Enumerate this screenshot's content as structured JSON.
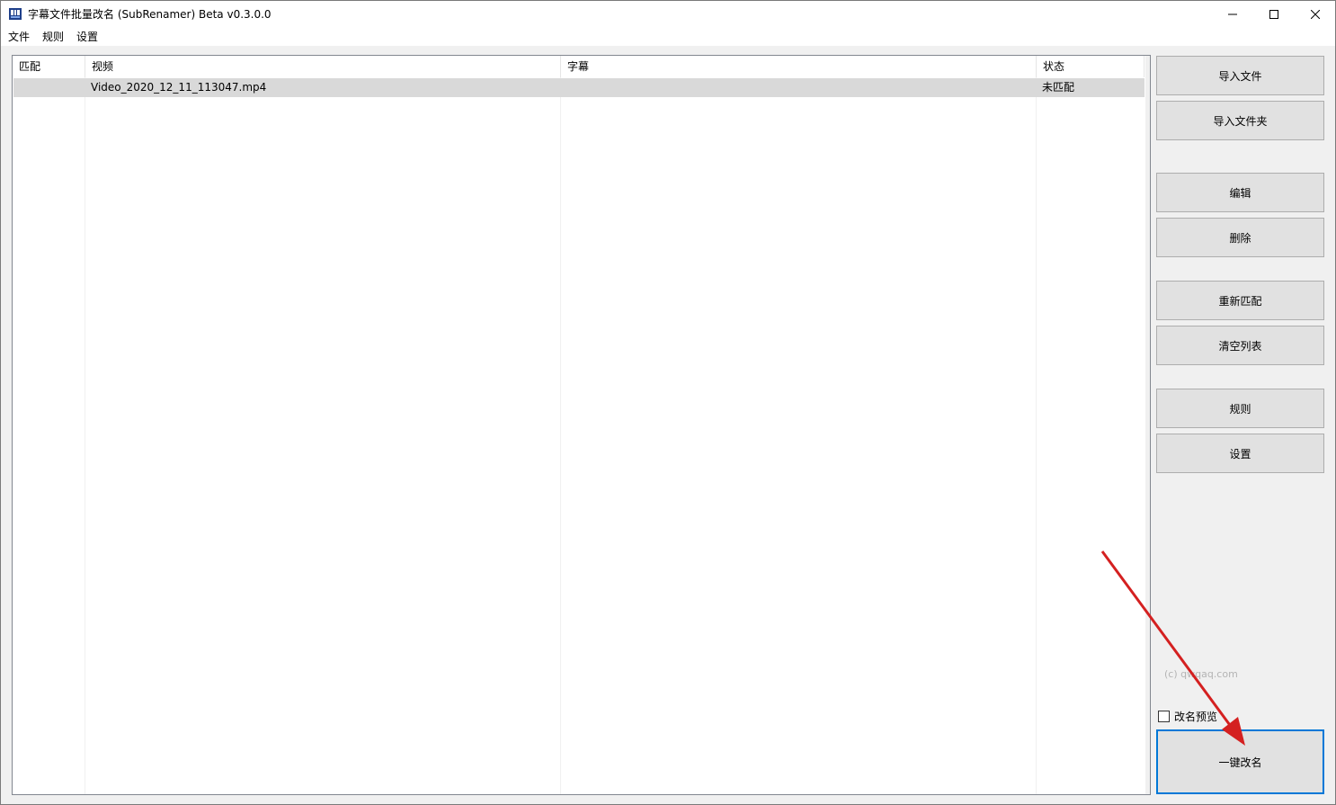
{
  "window": {
    "title": "字幕文件批量改名 (SubRenamer) Beta v0.3.0.0",
    "controls": {
      "minimize": "minimize-icon",
      "maximize": "maximize-icon",
      "close": "close-icon"
    }
  },
  "menu": {
    "items": [
      "文件",
      "规则",
      "设置"
    ]
  },
  "table": {
    "columns": [
      "匹配",
      "视频",
      "字幕",
      "状态"
    ],
    "rows": [
      {
        "match": "",
        "video": "Video_2020_12_11_113047.mp4",
        "subtitle": "",
        "status": "未匹配"
      }
    ]
  },
  "sidebar": {
    "import_file": "导入文件",
    "import_folder": "导入文件夹",
    "edit": "编辑",
    "delete": "删除",
    "rematch": "重新匹配",
    "clear_list": "清空列表",
    "rules": "规则",
    "settings": "设置",
    "copyright": "(c) qwqaq.com",
    "preview_label": "改名预览",
    "preview_checked": false,
    "rename_all": "一键改名"
  },
  "colors": {
    "accent": "#0078d7",
    "annotation_arrow": "#d42020",
    "row_selected": "#d9d9d9"
  }
}
